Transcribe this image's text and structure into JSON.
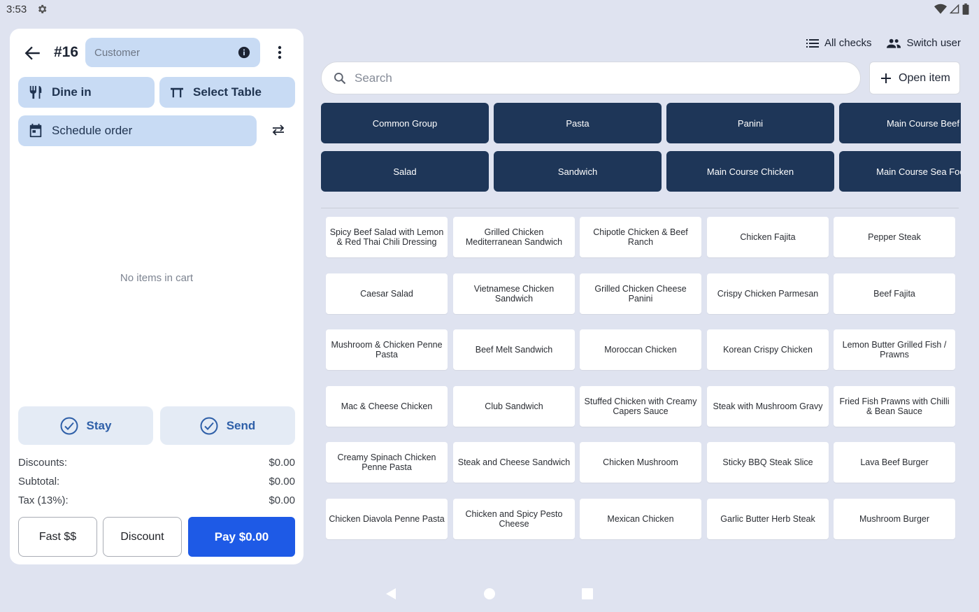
{
  "status_bar": {
    "time": "3:53",
    "icons": [
      "gear-icon",
      "wifi-icon",
      "signal-icon",
      "battery-icon"
    ]
  },
  "order": {
    "number": "#16",
    "customer_placeholder": "Customer",
    "dine_in_label": "Dine in",
    "select_table_label": "Select Table",
    "schedule_label": "Schedule order",
    "empty_cart_text": "No items in cart",
    "stay_label": "Stay",
    "send_label": "Send"
  },
  "totals": [
    {
      "label": "Discounts:",
      "value": "$0.00"
    },
    {
      "label": "Subtotal:",
      "value": "$0.00"
    },
    {
      "label": "Tax (13%):",
      "value": "$0.00"
    }
  ],
  "payment": {
    "fast_label": "Fast $$",
    "discount_label": "Discount",
    "pay_label": "Pay $0.00"
  },
  "header": {
    "all_checks_label": "All checks",
    "switch_user_label": "Switch user",
    "search_placeholder": "Search",
    "open_item_label": "Open item"
  },
  "groups": [
    "Common Group",
    "Pasta",
    "Panini",
    "Main Course Beef",
    "Salad",
    "Sandwich",
    "Main Course Chicken",
    "Main Course Sea Food"
  ],
  "items": [
    "Spicy Beef Salad with Lemon & Red Thai Chili Dressing",
    "Grilled Chicken Mediterranean Sandwich",
    "Chipotle Chicken & Beef Ranch",
    "Chicken Fajita",
    "Pepper Steak",
    "Caesar Salad",
    "Vietnamese Chicken Sandwich",
    "Grilled Chicken Cheese Panini",
    "Crispy Chicken Parmesan",
    "Beef Fajita",
    "Mushroom & Chicken Penne Pasta",
    "Beef Melt Sandwich",
    "Moroccan Chicken",
    "Korean Crispy Chicken",
    "Lemon Butter Grilled Fish / Prawns",
    "Mac & Cheese Chicken",
    "Club Sandwich",
    "Stuffed Chicken with Creamy Capers Sauce",
    "Steak with Mushroom Gravy",
    "Fried Fish Prawns with Chilli & Bean Sauce",
    "Creamy Spinach Chicken Penne Pasta",
    "Steak and Cheese Sandwich",
    "Chicken Mushroom",
    "Sticky BBQ Steak Slice",
    "Lava Beef Burger",
    "Chicken Diavola Penne Pasta",
    "Chicken and Spicy Pesto Cheese",
    "Mexican Chicken",
    "Garlic Butter Herb Steak",
    "Mushroom Burger"
  ],
  "colors": {
    "background": "#dfe3f0",
    "chip": "#c8dbf4",
    "group_button": "#1e3658",
    "pay_button": "#1e5ae6",
    "action_text": "#2e5fa8"
  }
}
